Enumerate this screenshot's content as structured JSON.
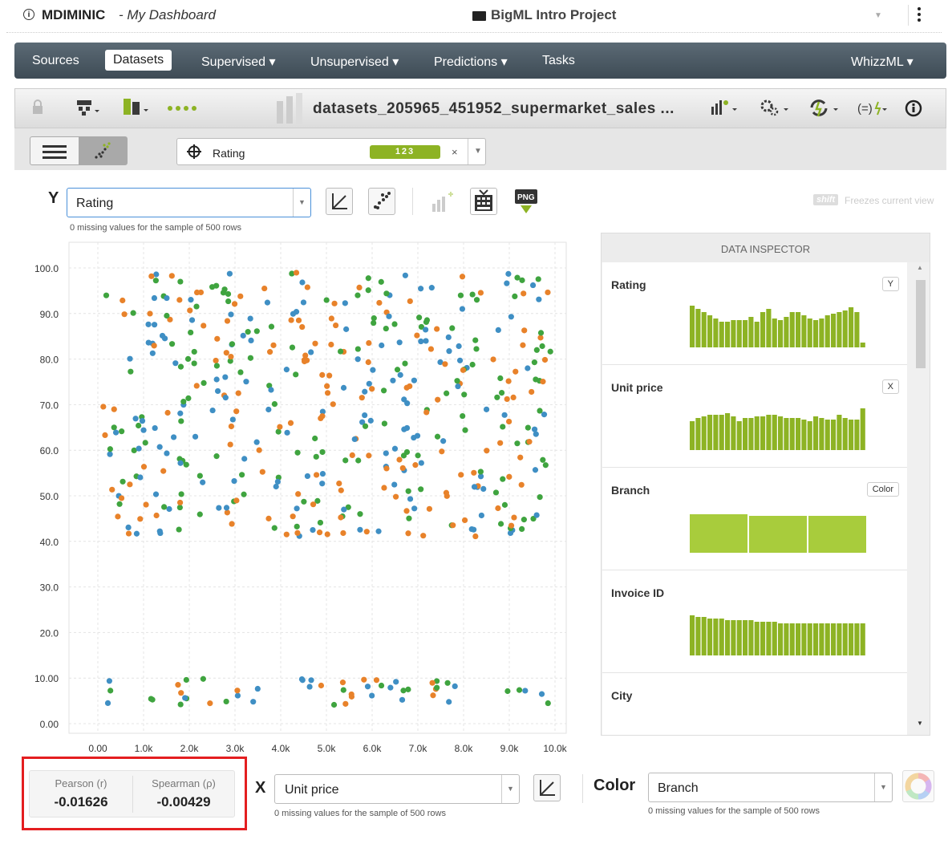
{
  "top": {
    "user": "MDIMINIC",
    "separator": " - ",
    "dashboard": "My Dashboard",
    "project": "BigML Intro Project"
  },
  "nav": {
    "sources": "Sources",
    "datasets": "Datasets",
    "supervised": "Supervised ▾",
    "unsupervised": "Unsupervised ▾",
    "predictions": "Predictions ▾",
    "tasks": "Tasks",
    "whizzml": "WhizzML ▾"
  },
  "toolbar": {
    "dataset_name": "datasets_205965_451952_supermarket_sales ..."
  },
  "field_selector": {
    "label": "Rating",
    "badge": "123"
  },
  "y_axis_control": {
    "letter": "Y",
    "value": "Rating",
    "missing": "0 missing values for the sample of 500 rows"
  },
  "freeze": {
    "key": "shift",
    "text": "Freezes current view"
  },
  "x_axis_control": {
    "letter": "X",
    "value": "Unit price",
    "missing": "0 missing values for the sample of 500 rows"
  },
  "color_control": {
    "letter": "Color",
    "value": "Branch",
    "missing": "0 missing values for the sample of 500 rows"
  },
  "stats": {
    "pearson_label": "Pearson (r)",
    "pearson_value": "-0.01626",
    "spearman_label": "Spearman (ρ)",
    "spearman_value": "-0.00429"
  },
  "inspector": {
    "title": "DATA INSPECTOR",
    "fields": [
      {
        "name": "Rating",
        "tag": "Y"
      },
      {
        "name": "Unit price",
        "tag": "X"
      },
      {
        "name": "Branch",
        "tag": "Color"
      },
      {
        "name": "Invoice ID",
        "tag": ""
      },
      {
        "name": "City",
        "tag": ""
      }
    ]
  },
  "colors": {
    "branch_a": "#e8822a",
    "branch_b": "#3f8fc4",
    "branch_c": "#3fa43f",
    "hist": "#8db324"
  },
  "chart_data": {
    "type": "scatter",
    "x_ticks": [
      "0.00",
      "1.0k",
      "2.0k",
      "3.0k",
      "4.0k",
      "5.0k",
      "6.0k",
      "7.0k",
      "8.0k",
      "9.0k",
      "10.0k"
    ],
    "y_ticks": [
      "0.00",
      "10.00",
      "20.0",
      "30.0",
      "40.0",
      "50.0",
      "60.0",
      "70.0",
      "80.0",
      "90.0",
      "100.0"
    ],
    "xlim": [
      0,
      10000
    ],
    "ylim": [
      0,
      100
    ],
    "grid": true
  }
}
